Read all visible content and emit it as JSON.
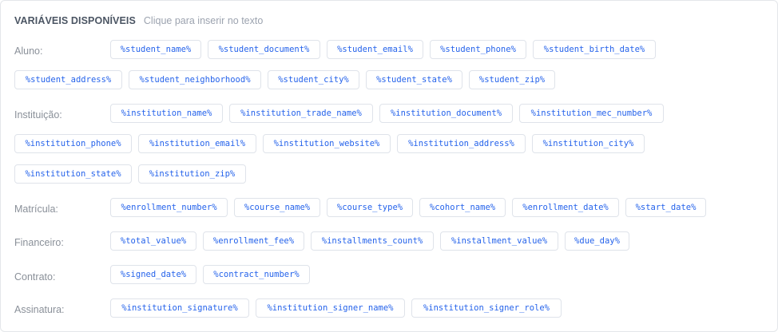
{
  "header": {
    "title": "VARIÁVEIS DISPONÍVEIS",
    "hint": "Clique para inserir no texto"
  },
  "groups": {
    "aluno": {
      "label": "Aluno:",
      "vars": [
        "%student_name%",
        "%student_document%",
        "%student_email%",
        "%student_phone%",
        "%student_birth_date%",
        "%student_address%",
        "%student_neighborhood%",
        "%student_city%",
        "%student_state%",
        "%student_zip%"
      ]
    },
    "instituicao": {
      "label": "Instituição:",
      "vars": [
        "%institution_name%",
        "%institution_trade_name%",
        "%institution_document%",
        "%institution_mec_number%",
        "%institution_phone%",
        "%institution_email%",
        "%institution_website%",
        "%institution_address%",
        "%institution_city%",
        "%institution_state%",
        "%institution_zip%"
      ]
    },
    "matricula": {
      "label": "Matrícula:",
      "vars": [
        "%enrollment_number%",
        "%course_name%",
        "%course_type%",
        "%cohort_name%",
        "%enrollment_date%",
        "%start_date%"
      ]
    },
    "financeiro": {
      "label": "Financeiro:",
      "vars": [
        "%total_value%",
        "%enrollment_fee%",
        "%installments_count%",
        "%installment_value%",
        "%due_day%"
      ]
    },
    "contrato": {
      "label": "Contrato:",
      "vars": [
        "%signed_date%",
        "%contract_number%"
      ]
    },
    "assinatura": {
      "label": "Assinatura:",
      "vars": [
        "%institution_signature%",
        "%institution_signer_name%",
        "%institution_signer_role%"
      ]
    }
  },
  "colors": {
    "chip_text": "#2563eb",
    "chip_border": "#dfe3ea",
    "label_text": "#8a9099",
    "title_text": "#4b5563"
  }
}
